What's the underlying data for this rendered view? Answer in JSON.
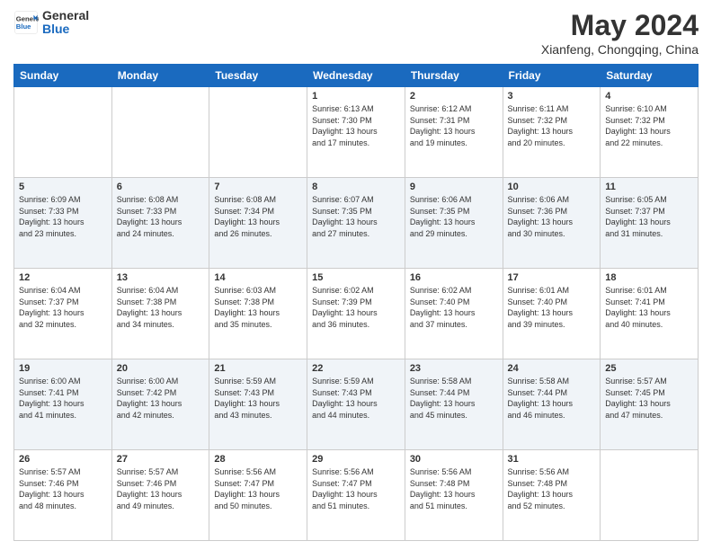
{
  "header": {
    "logo_line1": "General",
    "logo_line2": "Blue",
    "month": "May 2024",
    "location": "Xianfeng, Chongqing, China"
  },
  "days_of_week": [
    "Sunday",
    "Monday",
    "Tuesday",
    "Wednesday",
    "Thursday",
    "Friday",
    "Saturday"
  ],
  "weeks": [
    [
      {
        "day": "",
        "info": ""
      },
      {
        "day": "",
        "info": ""
      },
      {
        "day": "",
        "info": ""
      },
      {
        "day": "1",
        "info": "Sunrise: 6:13 AM\nSunset: 7:30 PM\nDaylight: 13 hours\nand 17 minutes."
      },
      {
        "day": "2",
        "info": "Sunrise: 6:12 AM\nSunset: 7:31 PM\nDaylight: 13 hours\nand 19 minutes."
      },
      {
        "day": "3",
        "info": "Sunrise: 6:11 AM\nSunset: 7:32 PM\nDaylight: 13 hours\nand 20 minutes."
      },
      {
        "day": "4",
        "info": "Sunrise: 6:10 AM\nSunset: 7:32 PM\nDaylight: 13 hours\nand 22 minutes."
      }
    ],
    [
      {
        "day": "5",
        "info": "Sunrise: 6:09 AM\nSunset: 7:33 PM\nDaylight: 13 hours\nand 23 minutes."
      },
      {
        "day": "6",
        "info": "Sunrise: 6:08 AM\nSunset: 7:33 PM\nDaylight: 13 hours\nand 24 minutes."
      },
      {
        "day": "7",
        "info": "Sunrise: 6:08 AM\nSunset: 7:34 PM\nDaylight: 13 hours\nand 26 minutes."
      },
      {
        "day": "8",
        "info": "Sunrise: 6:07 AM\nSunset: 7:35 PM\nDaylight: 13 hours\nand 27 minutes."
      },
      {
        "day": "9",
        "info": "Sunrise: 6:06 AM\nSunset: 7:35 PM\nDaylight: 13 hours\nand 29 minutes."
      },
      {
        "day": "10",
        "info": "Sunrise: 6:06 AM\nSunset: 7:36 PM\nDaylight: 13 hours\nand 30 minutes."
      },
      {
        "day": "11",
        "info": "Sunrise: 6:05 AM\nSunset: 7:37 PM\nDaylight: 13 hours\nand 31 minutes."
      }
    ],
    [
      {
        "day": "12",
        "info": "Sunrise: 6:04 AM\nSunset: 7:37 PM\nDaylight: 13 hours\nand 32 minutes."
      },
      {
        "day": "13",
        "info": "Sunrise: 6:04 AM\nSunset: 7:38 PM\nDaylight: 13 hours\nand 34 minutes."
      },
      {
        "day": "14",
        "info": "Sunrise: 6:03 AM\nSunset: 7:38 PM\nDaylight: 13 hours\nand 35 minutes."
      },
      {
        "day": "15",
        "info": "Sunrise: 6:02 AM\nSunset: 7:39 PM\nDaylight: 13 hours\nand 36 minutes."
      },
      {
        "day": "16",
        "info": "Sunrise: 6:02 AM\nSunset: 7:40 PM\nDaylight: 13 hours\nand 37 minutes."
      },
      {
        "day": "17",
        "info": "Sunrise: 6:01 AM\nSunset: 7:40 PM\nDaylight: 13 hours\nand 39 minutes."
      },
      {
        "day": "18",
        "info": "Sunrise: 6:01 AM\nSunset: 7:41 PM\nDaylight: 13 hours\nand 40 minutes."
      }
    ],
    [
      {
        "day": "19",
        "info": "Sunrise: 6:00 AM\nSunset: 7:41 PM\nDaylight: 13 hours\nand 41 minutes."
      },
      {
        "day": "20",
        "info": "Sunrise: 6:00 AM\nSunset: 7:42 PM\nDaylight: 13 hours\nand 42 minutes."
      },
      {
        "day": "21",
        "info": "Sunrise: 5:59 AM\nSunset: 7:43 PM\nDaylight: 13 hours\nand 43 minutes."
      },
      {
        "day": "22",
        "info": "Sunrise: 5:59 AM\nSunset: 7:43 PM\nDaylight: 13 hours\nand 44 minutes."
      },
      {
        "day": "23",
        "info": "Sunrise: 5:58 AM\nSunset: 7:44 PM\nDaylight: 13 hours\nand 45 minutes."
      },
      {
        "day": "24",
        "info": "Sunrise: 5:58 AM\nSunset: 7:44 PM\nDaylight: 13 hours\nand 46 minutes."
      },
      {
        "day": "25",
        "info": "Sunrise: 5:57 AM\nSunset: 7:45 PM\nDaylight: 13 hours\nand 47 minutes."
      }
    ],
    [
      {
        "day": "26",
        "info": "Sunrise: 5:57 AM\nSunset: 7:46 PM\nDaylight: 13 hours\nand 48 minutes."
      },
      {
        "day": "27",
        "info": "Sunrise: 5:57 AM\nSunset: 7:46 PM\nDaylight: 13 hours\nand 49 minutes."
      },
      {
        "day": "28",
        "info": "Sunrise: 5:56 AM\nSunset: 7:47 PM\nDaylight: 13 hours\nand 50 minutes."
      },
      {
        "day": "29",
        "info": "Sunrise: 5:56 AM\nSunset: 7:47 PM\nDaylight: 13 hours\nand 51 minutes."
      },
      {
        "day": "30",
        "info": "Sunrise: 5:56 AM\nSunset: 7:48 PM\nDaylight: 13 hours\nand 51 minutes."
      },
      {
        "day": "31",
        "info": "Sunrise: 5:56 AM\nSunset: 7:48 PM\nDaylight: 13 hours\nand 52 minutes."
      },
      {
        "day": "",
        "info": ""
      }
    ]
  ]
}
